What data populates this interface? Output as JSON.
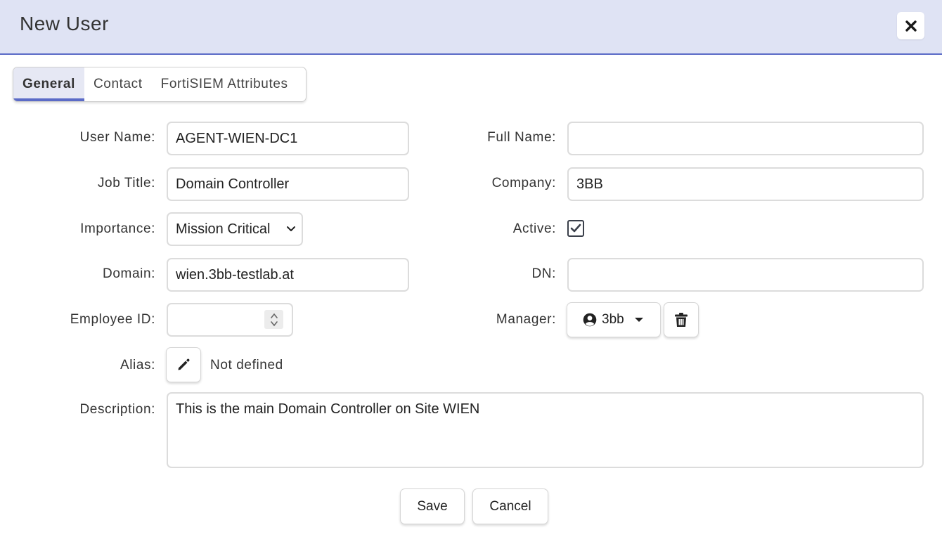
{
  "dialog": {
    "title": "New User"
  },
  "tabs": [
    {
      "label": "General"
    },
    {
      "label": "Contact"
    },
    {
      "label": "FortiSIEM Attributes"
    }
  ],
  "form": {
    "user_name": {
      "label": "User Name:",
      "value": "AGENT-WIEN-DC1"
    },
    "full_name": {
      "label": "Full Name:",
      "value": ""
    },
    "job_title": {
      "label": "Job Title:",
      "value": "Domain Controller"
    },
    "company": {
      "label": "Company:",
      "value": "3BB"
    },
    "importance": {
      "label": "Importance:",
      "value": "Mission Critical"
    },
    "active": {
      "label": "Active:",
      "checked": true
    },
    "domain": {
      "label": "Domain:",
      "value": "wien.3bb-testlab.at"
    },
    "dn": {
      "label": "DN:",
      "value": ""
    },
    "employee_id": {
      "label": "Employee ID:",
      "value": ""
    },
    "manager": {
      "label": "Manager:",
      "value": "3bb"
    },
    "alias": {
      "label": "Alias:",
      "value": "Not defined"
    },
    "description": {
      "label": "Description:",
      "value": "This is the main Domain Controller on Site WIEN"
    }
  },
  "buttons": {
    "save": "Save",
    "cancel": "Cancel"
  },
  "icons": {
    "close": "close-icon",
    "chevron": "chevron-down-icon",
    "user": "user-circle-icon",
    "caret": "caret-down-icon",
    "trash": "trash-icon",
    "pencil": "pencil-icon",
    "check": "check-icon"
  },
  "colors": {
    "header_bg": "#dfe3f4",
    "accent": "#5b6bc7"
  }
}
